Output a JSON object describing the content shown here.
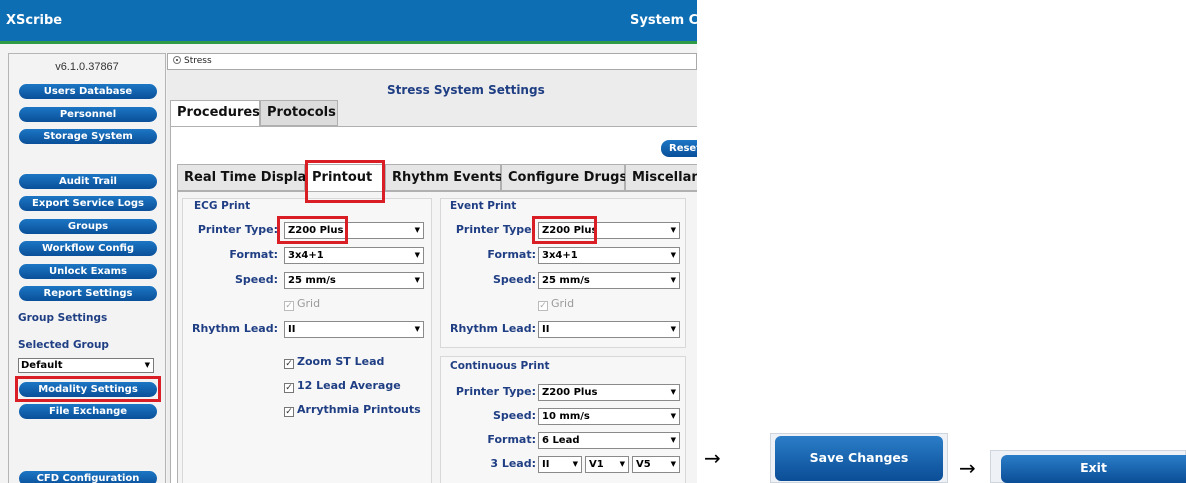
{
  "app": {
    "title_left": "XScribe",
    "title_right": "System C",
    "version": "v6.1.0.37867"
  },
  "sidebar": {
    "buttons": [
      "Users Database",
      "Personnel",
      "Storage System",
      "Audit Trail",
      "Export Service Logs",
      "Groups",
      "Workflow Config",
      "Unlock Exams",
      "Report Settings",
      "Modality Settings",
      "File Exchange",
      "CFD Configuration"
    ],
    "group_settings_label": "Group Settings",
    "selected_group_label": "Selected Group",
    "selected_group_value": "Default"
  },
  "main": {
    "breadcrumb": "Stress",
    "title": "Stress System Settings",
    "tabs": [
      "Procedures",
      "Protocols"
    ],
    "reset_label": "Reset",
    "subtabs": [
      "Real Time Display",
      "Printout",
      "Rhythm Events",
      "Configure Drugs",
      "Miscellane"
    ]
  },
  "ecg_print": {
    "title": "ECG Print",
    "printer_type_label": "Printer Type:",
    "printer_type": "Z200 Plus",
    "format_label": "Format:",
    "format": "3x4+1",
    "speed_label": "Speed:",
    "speed": "25 mm/s",
    "grid_label": "Grid",
    "rhythm_lead_label": "Rhythm Lead:",
    "rhythm_lead": "II",
    "checks": [
      "Zoom ST Lead",
      "12 Lead Average",
      "Arrythmia Printouts"
    ]
  },
  "event_print": {
    "title": "Event Print",
    "printer_type_label": "Printer Type:",
    "printer_type": "Z200 Plus",
    "format_label": "Format:",
    "format": "3x4+1",
    "speed_label": "Speed:",
    "speed": "25 mm/s",
    "grid_label": "Grid",
    "rhythm_lead_label": "Rhythm Lead:",
    "rhythm_lead": "II"
  },
  "continuous_print": {
    "title": "Continuous Print",
    "printer_type_label": "Printer Type:",
    "printer_type": "Z200 Plus",
    "speed_label": "Speed:",
    "speed": "10 mm/s",
    "format_label": "Format:",
    "format": "6 Lead",
    "lead3_label": "3 Lead:",
    "lead3": [
      "II",
      "V1",
      "V5"
    ]
  },
  "actions": {
    "arrow": "→",
    "save_label": "Save Changes",
    "exit_label": "Exit"
  },
  "icons": {
    "dropdown": "chevron-down-icon",
    "arrow": "right-arrow-icon",
    "radio": "radio-icon"
  },
  "colors": {
    "titlebar": "#0d6eb4",
    "accent_line": "#2f9a48",
    "button": "#0a4f99",
    "highlight": "#d91e26",
    "label": "#1f3e83"
  }
}
